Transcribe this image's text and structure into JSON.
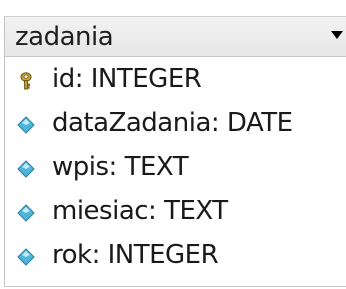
{
  "table": {
    "name": "zadania",
    "fields": [
      {
        "label": "id: INTEGER",
        "icon": "primary-key-icon"
      },
      {
        "label": "dataZadania: DATE",
        "icon": "field-diamond-icon"
      },
      {
        "label": "wpis: TEXT",
        "icon": "field-diamond-icon"
      },
      {
        "label": "miesiac: TEXT",
        "icon": "field-diamond-icon"
      },
      {
        "label": "rok: INTEGER",
        "icon": "field-diamond-icon"
      }
    ]
  },
  "colors": {
    "diamond_fill": "#4fb6d9",
    "diamond_highlight": "#bfe9f7",
    "key_gold": "#c9a23a"
  }
}
